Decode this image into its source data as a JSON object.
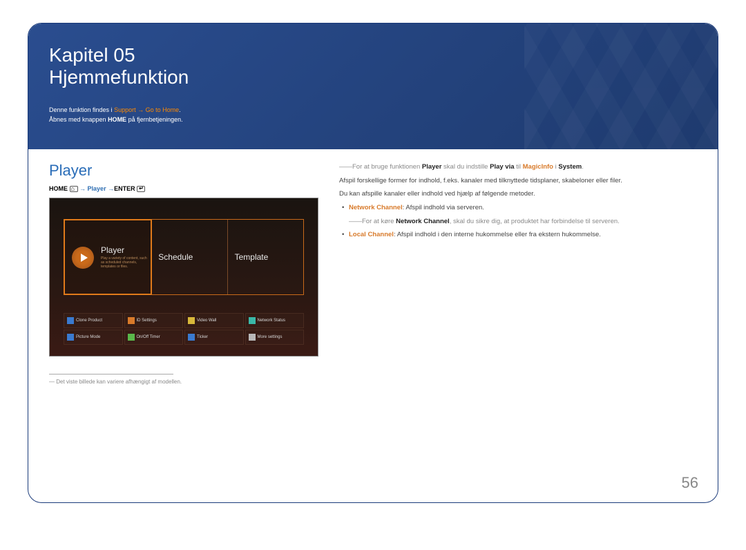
{
  "chapter": {
    "label": "Kapitel",
    "num": "05",
    "title": "Hjemmefunktion"
  },
  "sub": {
    "t1a": "Denne funktion findes i ",
    "t1b": "Support",
    "t1c": " → ",
    "t1d": "Go to Home",
    "t1e": ".",
    "t2a": "Åbnes med knappen ",
    "t2b": "HOME",
    "t2c": " på fjernbetjeningen."
  },
  "section": {
    "title": "Player"
  },
  "breadcrumb": {
    "home": "HOME",
    "arrow1": " → ",
    "player": "Player",
    "arrow2": " →",
    "enter": "ENTER"
  },
  "ss": {
    "tile1_title": "Player",
    "tile1_desc": "Play a variety of content, such as scheduled channels, templates or files.",
    "tile2_title": "Schedule",
    "tile3_title": "Template",
    "grid": [
      "Clone Product",
      "ID Settings",
      "Video Wall",
      "Network Status",
      "Picture Mode",
      "On/Off Timer",
      "Ticker",
      "More settings"
    ]
  },
  "footnote": "Det viste billede kan variere afhængigt af modellen.",
  "r": {
    "note_prefix": "――For at bruge funktionen ",
    "note_player": "Player",
    "note_mid": " skal du indstille ",
    "note_playvia": "Play via",
    "note_til": " til ",
    "note_magic": "MagicInfo",
    "note_i": " i ",
    "note_system": "System",
    "note_dot": ".",
    "p1": "Afspil forskellige former for indhold, f.eks. kanaler med tilknyttede tidsplaner, skabeloner eller filer.",
    "p2": "Du kan afspille kanaler eller indhold ved hjælp af følgende metoder.",
    "li1a": "Network Channel",
    "li1b": ": Afspil indhold via serveren.",
    "li1note_a": "――For at køre ",
    "li1note_b": "Network Channel",
    "li1note_c": ", skal du sikre dig, at produktet har forbindelse til serveren.",
    "li2a": "Local Channel",
    "li2b": ": Afspil indhold i den interne hukommelse eller fra ekstern hukommelse."
  },
  "page_num": "56"
}
